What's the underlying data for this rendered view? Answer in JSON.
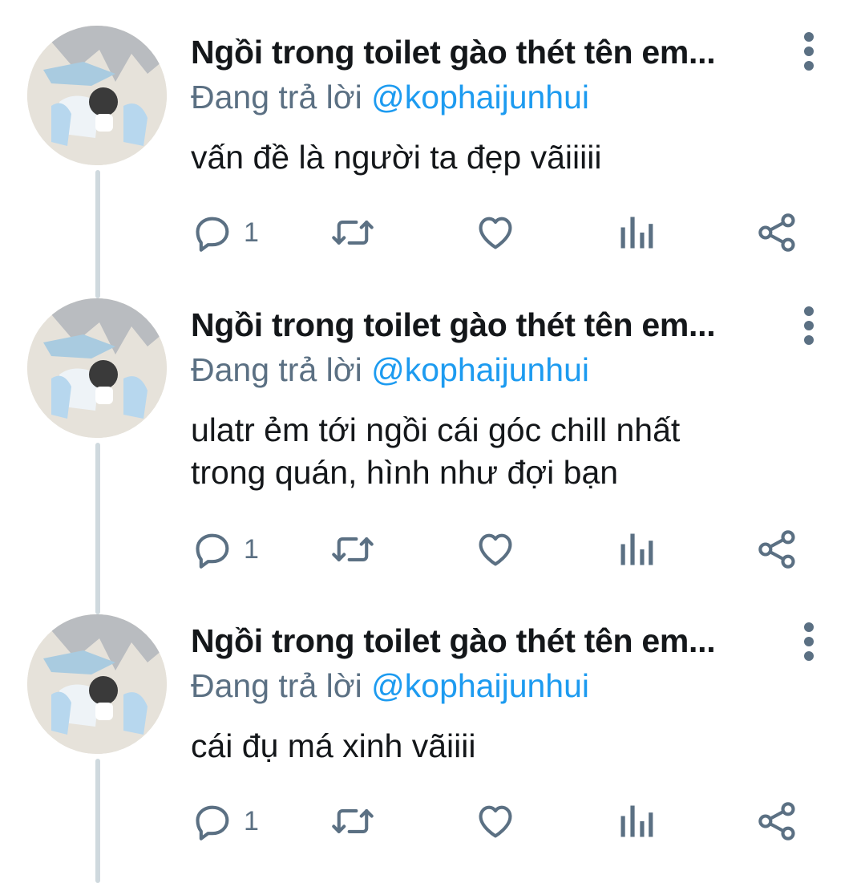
{
  "colors": {
    "text": "#14171a",
    "secondary": "#5b7083",
    "link": "#1d9bf0",
    "thread_line": "#cfd9de"
  },
  "tweets": [
    {
      "display_name": "Ngồi trong toilet gào thét tên em...",
      "reply_prefix": "Đang trả lời",
      "reply_handle": "@kophaijunhui",
      "text_lines": [
        "vấn đề là người ta đẹp vãiiiii"
      ],
      "reply_count": "1"
    },
    {
      "display_name": "Ngồi trong toilet gào thét tên em...",
      "reply_prefix": "Đang trả lời",
      "reply_handle": "@kophaijunhui",
      "text_lines": [
        "ulatr ẻm tới ngồi cái góc chill nhất",
        "trong quán, hình như đợi bạn"
      ],
      "reply_count": "1"
    },
    {
      "display_name": "Ngồi trong toilet gào thét tên em...",
      "reply_prefix": "Đang trả lời",
      "reply_handle": "@kophaijunhui",
      "text_lines": [
        "cái đụ má xinh vãiiii"
      ],
      "reply_count": "1"
    }
  ],
  "icons": {
    "reply": "reply-bubble-icon",
    "retweet": "retweet-icon",
    "like": "heart-icon",
    "analytics": "analytics-bars-icon",
    "share": "share-icon",
    "more": "more-vertical-icon"
  }
}
